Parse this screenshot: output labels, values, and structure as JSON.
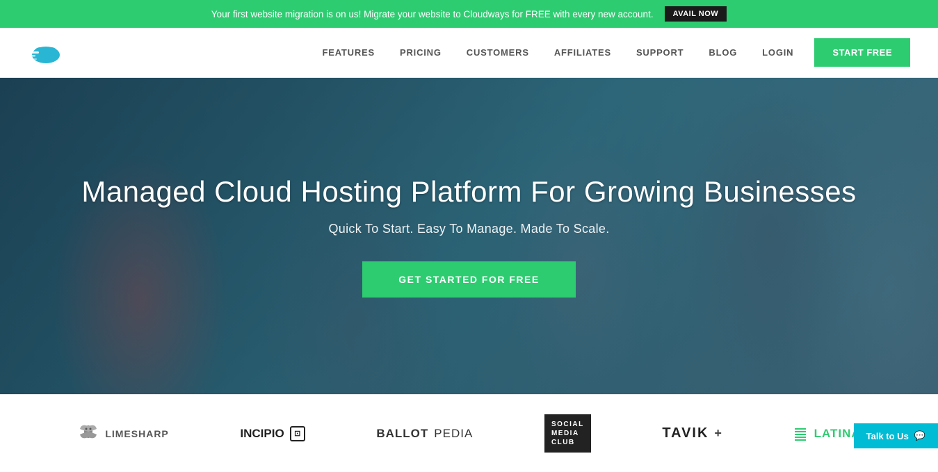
{
  "banner": {
    "text": "Your first website migration is on us! Migrate your website to Cloudways for FREE with every new account.",
    "cta_label": "AVAIL NOW"
  },
  "nav": {
    "features_label": "FEATURES",
    "pricing_label": "PRICING",
    "customers_label": "CUSTOMERS",
    "affiliates_label": "AFFILIATES",
    "support_label": "SUPPORT",
    "blog_label": "BLOG",
    "login_label": "LOGIN",
    "start_free_label": "START FREE"
  },
  "hero": {
    "title": "Managed Cloud Hosting Platform For Growing Businesses",
    "subtitle": "Quick To Start. Easy To Manage. Made To Scale.",
    "cta_label": "GET STARTED FOR FREE"
  },
  "logos": [
    {
      "id": "limesharp",
      "name": "LIMESHARP",
      "type": "limesharp"
    },
    {
      "id": "incipio",
      "name": "INCIPIO",
      "type": "incipio"
    },
    {
      "id": "ballotpedia",
      "name": "BALLOTPEDIA",
      "type": "ballotpedia"
    },
    {
      "id": "socialmedia",
      "name": "SOCIAL MEDIA CLUB",
      "type": "socialmedia"
    },
    {
      "id": "tavik",
      "name": "TAVIK+",
      "type": "tavik"
    },
    {
      "id": "latina",
      "name": "Latina",
      "type": "latina"
    }
  ],
  "talk_widget": {
    "label": "Talk to Us"
  },
  "colors": {
    "green": "#2ecc71",
    "dark": "#1a1a1a",
    "nav_link": "#555"
  }
}
